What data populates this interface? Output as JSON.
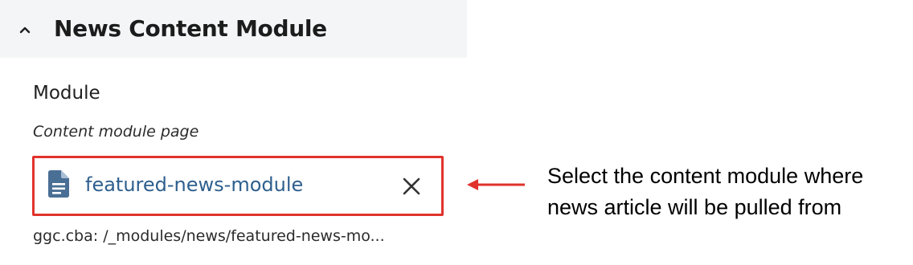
{
  "section": {
    "title": "News Content Module",
    "toggle_icon": "chevron-up-icon"
  },
  "field": {
    "label": "Module",
    "help_text": "Content module page",
    "selected_page": {
      "icon": "file-document-icon",
      "name": "featured-news-module",
      "path": "ggc.cba: /_modules/news/featured-news-mo...",
      "clear_icon": "close-icon"
    }
  },
  "annotation": {
    "lines": [
      "Select the content module where",
      "news article will be pulled from"
    ],
    "arrow_icon": "arrow-left-icon"
  },
  "colors": {
    "header_bg": "#f4f5f6",
    "link": "#2e5f8e",
    "highlight": "#e0332c",
    "icon": "#4a6f95"
  }
}
